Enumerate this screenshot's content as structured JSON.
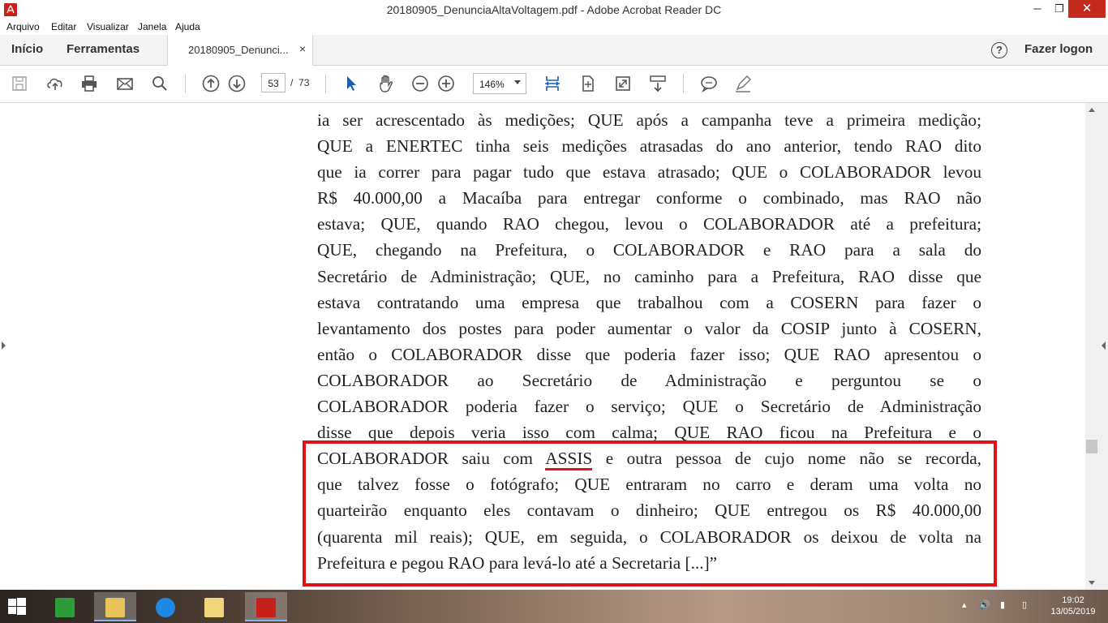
{
  "window": {
    "title": "20180905_DenunciaAltaVoltagem.pdf - Adobe Acrobat Reader DC",
    "minimize": "─",
    "maximize": "❐",
    "close": "✕"
  },
  "menu": {
    "items": [
      "Arquivo",
      "Editar",
      "Visualizar",
      "Janela",
      "Ajuda"
    ]
  },
  "tabs": {
    "home": "Início",
    "tools": "Ferramentas",
    "document": "20180905_Denunci...",
    "document_close": "×",
    "help": "?",
    "login": "Fazer logon"
  },
  "toolbar": {
    "current_page": "53",
    "page_separator": "/",
    "total_pages": "73",
    "zoom": "146%",
    "icons": [
      "save-icon",
      "upload-icon",
      "print-icon",
      "email-icon",
      "search-icon",
      "prev-page-icon",
      "next-page-icon",
      "select-cursor-icon",
      "hand-icon",
      "zoom-out-icon",
      "zoom-in-icon",
      "fit-width-icon",
      "fit-page-icon",
      "full-screen-icon",
      "scroll-mode-icon",
      "comment-icon",
      "sign-icon"
    ]
  },
  "document": {
    "lines": [
      "ia ser acrescentado às medições; QUE após a campanha teve a primeira medição;",
      "QUE a ENERTEC tinha seis medições atrasadas do ano anterior, tendo RAO dito",
      "que ia correr para pagar tudo que estava atrasado; QUE o COLABORADOR levou",
      "R$ 40.000,00 a Macaíba para entregar conforme o combinado, mas RAO não",
      "estava; QUE, quando RAO chegou, levou o COLABORADOR até a prefeitura;",
      "QUE, chegando na Prefeitura, o COLABORADOR e RAO para a sala do",
      "Secretário de Administração; QUE, no caminho para a Prefeitura, RAO disse que",
      "estava contratando uma empresa que trabalhou com a COSERN para fazer o",
      "levantamento dos postes para poder aumentar o valor da COSIP junto à COSERN,",
      "então o COLABORADOR disse que poderia fazer isso; QUE RAO apresentou o",
      "COLABORADOR ao Secretário de Administração e perguntou se o",
      "COLABORADOR poderia fazer o serviço; QUE o Secretário de Administração",
      "disse que depois veria isso com calma; QUE RAO ficou na Prefeitura e o"
    ],
    "highlight_line_before": "COLABORADOR saiu com",
    "highlight_word": "ASSIS",
    "highlight_line_after": "e outra pessoa de cujo nome não se recorda,",
    "highlight_lines": [
      "que talvez fosse o fotógrafo; QUE entraram no carro e deram uma volta no",
      "quarteirão enquanto eles contavam o dinheiro; QUE entregou os R$ 40.000,00",
      "(quarenta mil reais); QUE, em seguida, o COLABORADOR os deixou de volta na"
    ],
    "last_line": "Prefeitura e pegou RAO para levá-lo até a Secretaria [...]”"
  },
  "taskbar": {
    "apps": [
      "windows-start-icon",
      "store-icon",
      "file-explorer-icon",
      "internet-explorer-icon",
      "folder-icon",
      "acrobat-icon"
    ],
    "time": "19:02",
    "date": "13/05/2019"
  },
  "colors": {
    "accent_red": "#e01219",
    "acrobat_red": "#c8201b"
  }
}
